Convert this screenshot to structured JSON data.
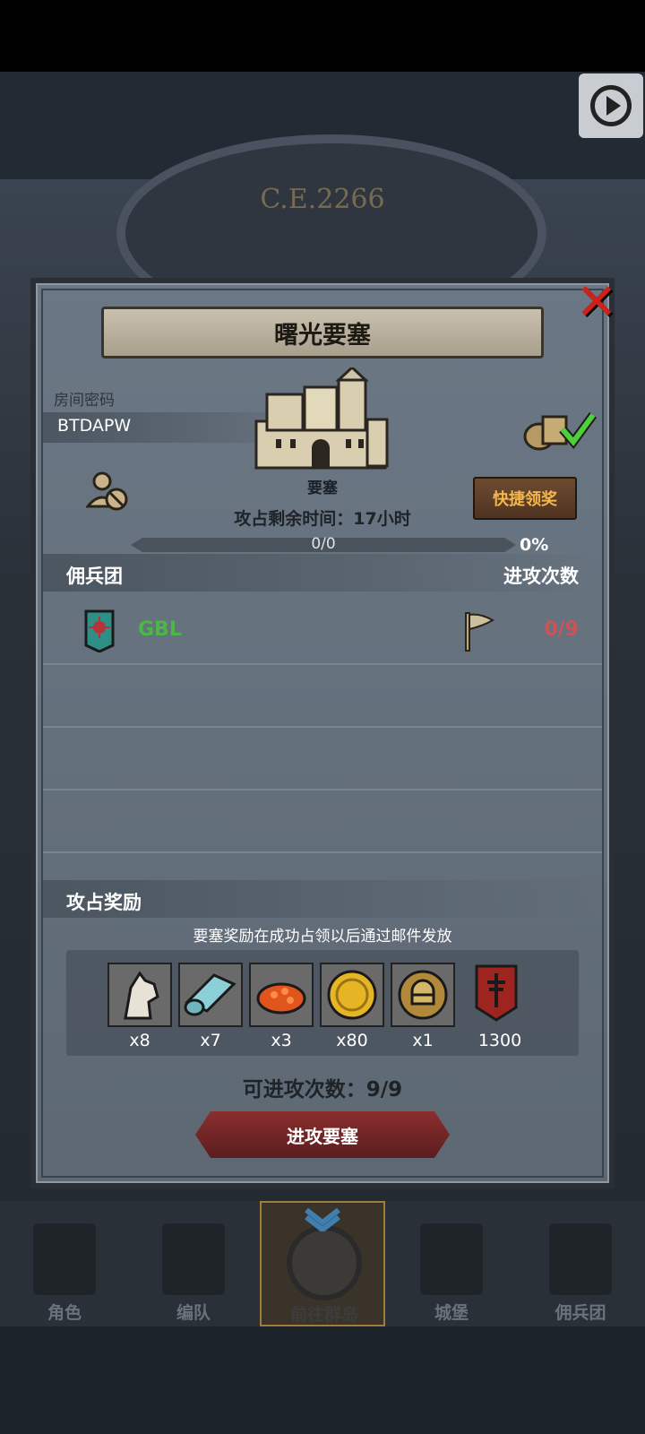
{
  "background": {
    "year_text": "C.E.2266"
  },
  "dialog": {
    "title": "曙光要塞",
    "room_label": "房间密码",
    "room_code": "BTDAPW",
    "castle_label": "要塞",
    "quick_claim_label": "快捷领奖",
    "remaining_time": "攻占剩余时间：17小时",
    "progress": {
      "text": "0/0",
      "percent_label": "0%",
      "fraction": 0
    },
    "guild_section": {
      "left_header": "佣兵团",
      "right_header": "进攻次数"
    },
    "guilds": [
      {
        "name": "GBL",
        "attacks": "0/9"
      }
    ],
    "reward_section": {
      "header": "攻占奖励",
      "note": "要塞奖励在成功占领以后通过邮件发放",
      "items": [
        {
          "icon": "horse-icon",
          "qty": "x8"
        },
        {
          "icon": "cloth-icon",
          "qty": "x7"
        },
        {
          "icon": "caviar-icon",
          "qty": "x3"
        },
        {
          "icon": "gold-coin-icon",
          "qty": "x80"
        },
        {
          "icon": "knight-medal-icon",
          "qty": "x1"
        },
        {
          "icon": "guild-banner-icon",
          "qty": "1300"
        }
      ]
    },
    "attacks_available": "可进攻次数：9/9",
    "attack_button": "进攻要塞"
  },
  "bottom_nav": [
    {
      "label": "角色",
      "icon": "knight-icon"
    },
    {
      "label": "编队",
      "icon": "squad-icon"
    },
    {
      "label": "前往群岛",
      "icon": "compass-icon",
      "active": true
    },
    {
      "label": "城堡",
      "icon": "castle-icon"
    },
    {
      "label": "佣兵团",
      "icon": "ship-icon"
    }
  ],
  "colors": {
    "guild_name": "#49b845",
    "attack_count": "#c9555a",
    "quick_claim": "#f5b74b",
    "close": "#d0201a"
  }
}
